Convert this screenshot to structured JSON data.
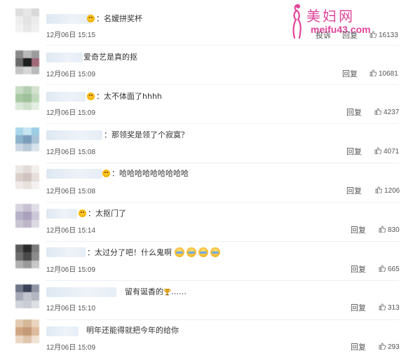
{
  "watermark": {
    "title": "美妇网",
    "url": "meifu43.com"
  },
  "comments": [
    {
      "text": "：名嫒拼奖杯",
      "time": "12月06日 15:15",
      "reply": "投诉",
      "reply2": "回复",
      "likes": "16133"
    },
    {
      "text": "爱奇艺是真的抠",
      "time": "12月06日 15:09",
      "reply": "回复",
      "likes": "10681"
    },
    {
      "text": "：太不体面了hhhh",
      "time": "12月06日 15:09",
      "reply": "回复",
      "likes": "4237"
    },
    {
      "text": "：那领奖是领了个寂寞？",
      "time": "12月06日 15:08",
      "reply": "回复",
      "likes": "4071"
    },
    {
      "text": "：哈哈哈哈哈哈哈哈哈",
      "time": "12月06日 15:08",
      "reply": "回复",
      "likes": "1206"
    },
    {
      "text": "：太抠门了",
      "time": "12月06日 15:14",
      "reply": "回复",
      "likes": "830"
    },
    {
      "text": "：太过分了吧！什么鬼啊",
      "time": "12月06日 15:09",
      "reply": "回复",
      "likes": "665"
    },
    {
      "text": "留有诞香的",
      "suffix": "……",
      "time": "12月06日 15:10",
      "reply": "回复",
      "likes": "313"
    },
    {
      "text": "明年还能得就把今年的给你",
      "time": "12月06日 15:09",
      "reply": "回复",
      "likes": "293"
    }
  ],
  "icons": {
    "like": "thumbs-up-icon",
    "emoji": "smiley-icon",
    "cry": "crying-laugh-icon",
    "trophy": "trophy-icon",
    "logo": "woman-silhouette-icon"
  },
  "colors": {
    "watermark": "#e0449a",
    "link": "#555555",
    "separator": "#eceff3"
  }
}
